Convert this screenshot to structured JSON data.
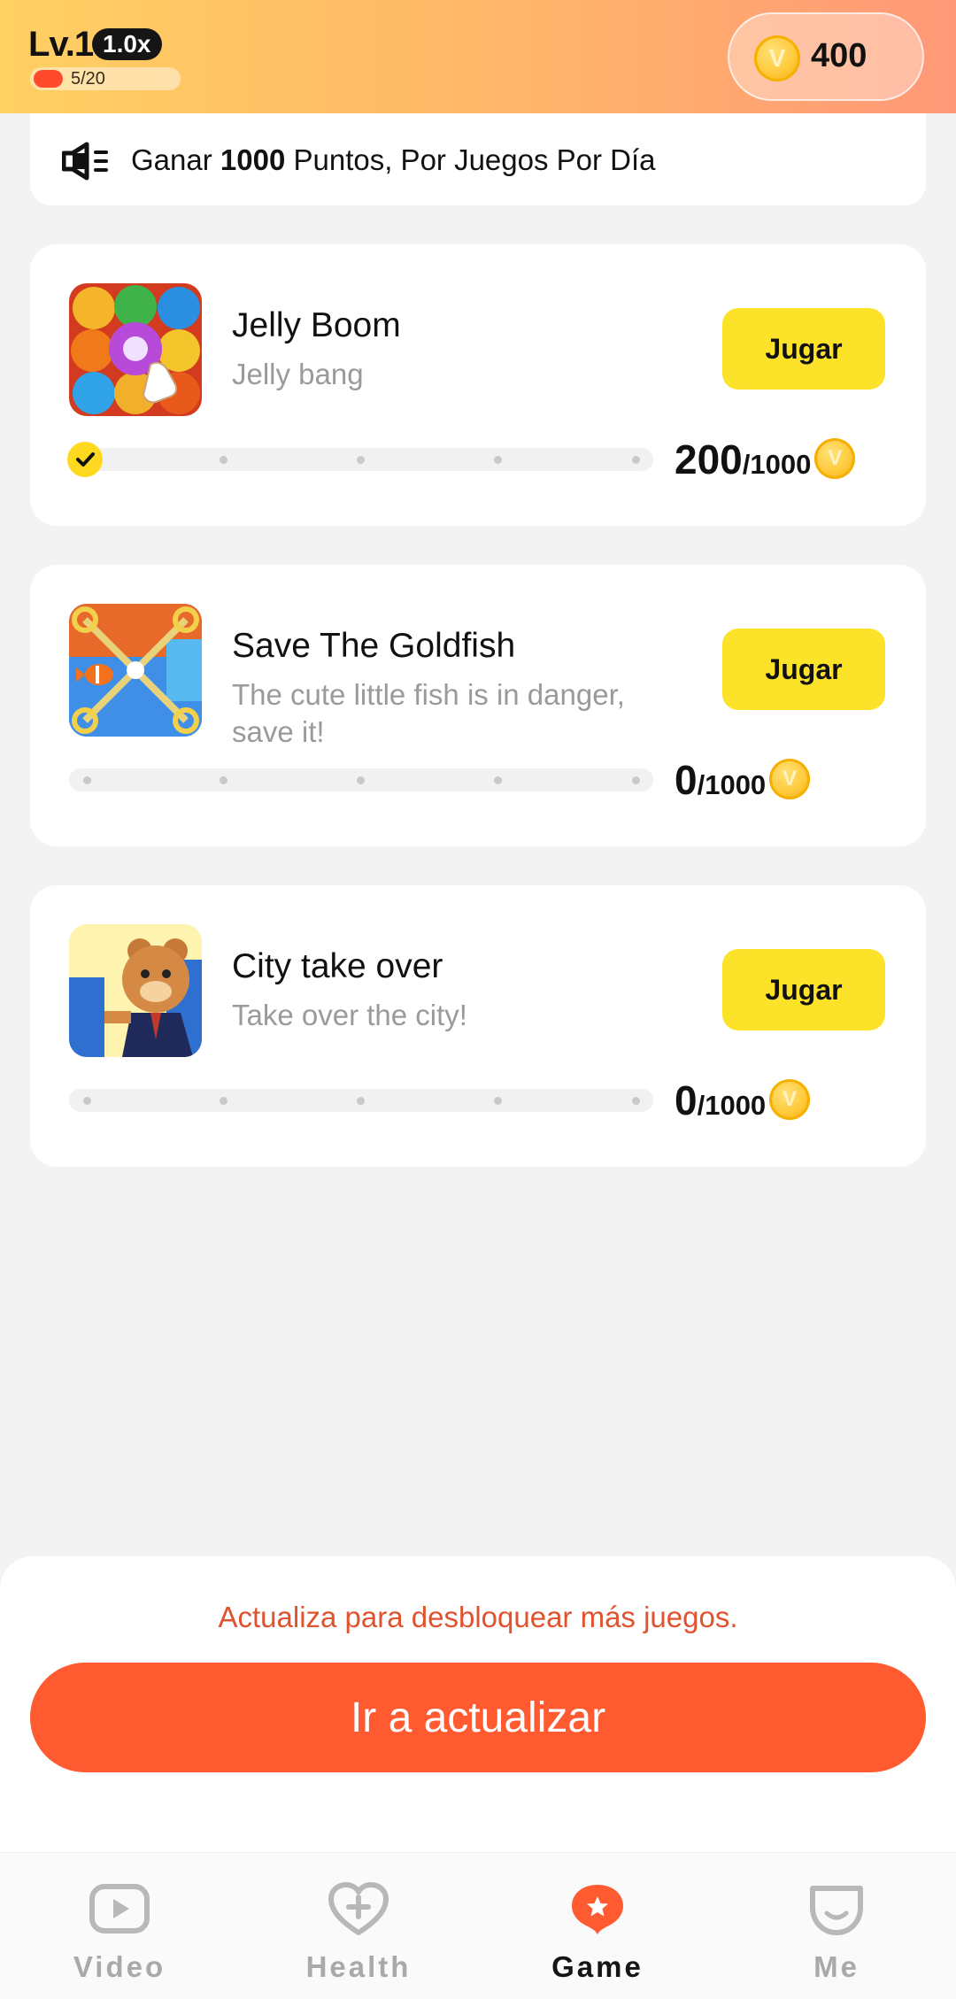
{
  "header": {
    "level": "Lv.1",
    "multiplier": "1.0x",
    "progress_text": "5/20",
    "progress_fraction": 0.25,
    "coins": "400"
  },
  "notice": {
    "prefix": "Ganar",
    "amount": "1000",
    "suffix": "Puntos, Por Juegos Por Día",
    "icon": "speaker-icon"
  },
  "games": [
    {
      "title": "Jelly Boom",
      "subtitle": "Jelly bang",
      "button": "Jugar",
      "score": "200",
      "goal": "/1000",
      "completed_steps": 1,
      "total_steps": 5
    },
    {
      "title": "Save The Goldfish",
      "subtitle": "The cute little fish is in danger, save it!",
      "button": "Jugar",
      "score": "0",
      "goal": "/1000",
      "completed_steps": 0,
      "total_steps": 5
    },
    {
      "title": "City take over",
      "subtitle": "Take over the city!",
      "button": "Jugar",
      "score": "0",
      "goal": "/1000",
      "completed_steps": 0,
      "total_steps": 5
    }
  ],
  "upgrade": {
    "message": "Actualiza para desbloquear más juegos.",
    "button": "Ir a actualizar"
  },
  "nav": {
    "items": [
      {
        "label": "Video",
        "icon": "video-icon",
        "active": false
      },
      {
        "label": "Health",
        "icon": "health-icon",
        "active": false
      },
      {
        "label": "Game",
        "icon": "game-icon",
        "active": true
      },
      {
        "label": "Me",
        "icon": "profile-icon",
        "active": false
      }
    ]
  },
  "colors": {
    "accent_orange": "#ff5a30",
    "play_yellow": "#fde22a",
    "coin_gold": "#ffc93a",
    "header_start": "#ffd062",
    "header_end": "#ff9878"
  }
}
